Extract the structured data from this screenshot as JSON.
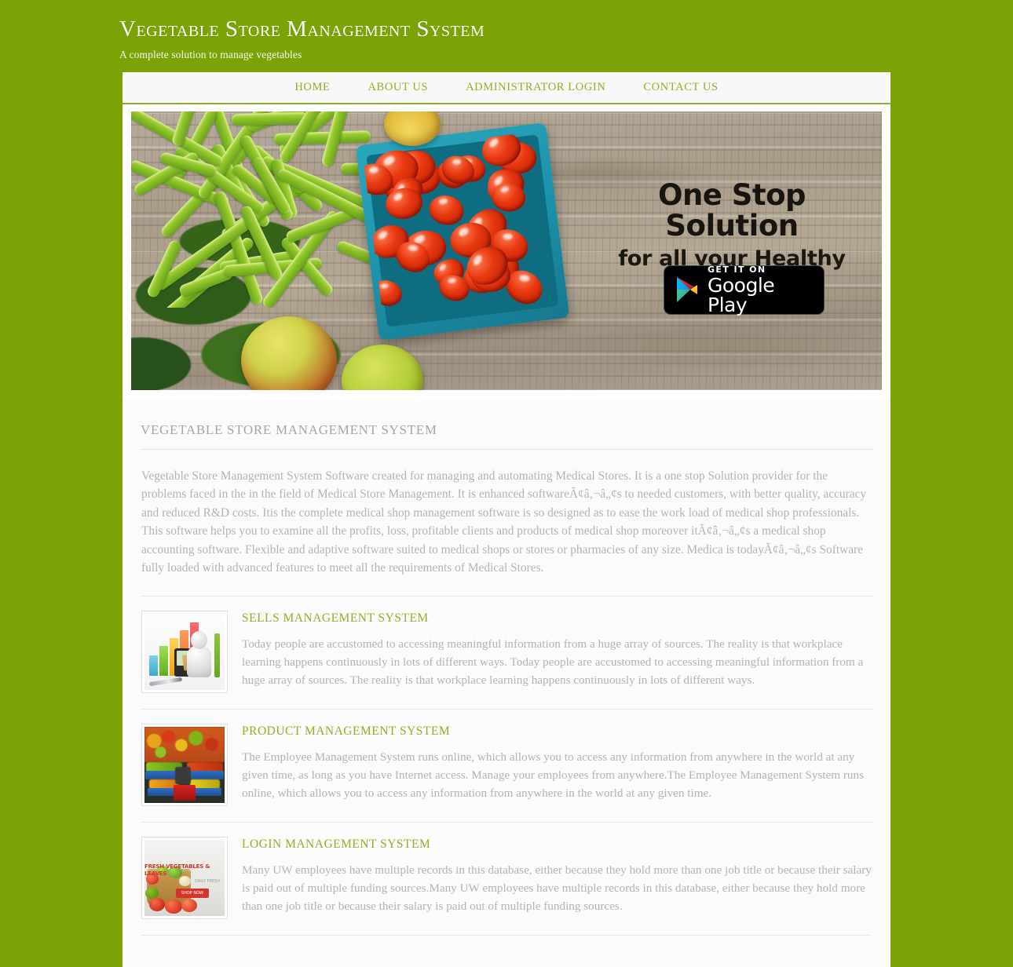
{
  "header": {
    "title": "Vegetable Store Management System",
    "tagline": "A complete solution to manage vegetables"
  },
  "nav": {
    "items": [
      {
        "label": "Home"
      },
      {
        "label": "About Us"
      },
      {
        "label": "Administrator Login"
      },
      {
        "label": "Contact Us"
      }
    ]
  },
  "banner": {
    "headline": "One Stop Solution",
    "subheadline": "for all your Healthy Needs",
    "badge": {
      "small_label": "GET IT ON",
      "big_label": "Google Play",
      "icon": "google-play-triangle-icon"
    },
    "image_alt": "green beans, cherry tomatoes in teal basket and apples on weathered wood"
  },
  "main": {
    "section_title": "Vegetable Store Management System",
    "intro": "Vegetable Store Management System Software created for managing and automating Medical Stores. It is a one stop Solution provider for the problems faced in the in the field of Medical Store Management. It is enhanced softwareÃ¢â‚¬â„¢s to needed customers, with better quality, accuracy and reduced R&D costs. Itis the complete medical shop management software is so designed as to ease the work load of medical shop professionals. This software helps you to examine all the profits, loss, profitable clients and products of medical shop moreover itÃ¢â‚¬â„¢s a medical shop accounting software. Flexible and adaptive software suited to medical shops or stores or pharmacies of any size. Medica is todayÃ¢â‚¬â„¢s Software fully loaded with advanced features to meet all the requirements of Medical Stores.",
    "features": [
      {
        "title": "Sells Management System",
        "text": "Today people are accustomed to accessing meaningful information from a huge array of sources. The reality is that workplace learning happens continuously in lots of different ways. Today people are accustomed to accessing meaningful information from a huge array of sources. The reality is that workplace learning happens continuously in lots of different ways.",
        "thumb_alt": "3d figure with pencil, bar chart and calculator"
      },
      {
        "title": "Product Management System",
        "text": "The Employee Management System runs online, which allows you to access any information from anywhere in the world at any given time, as long as you have Internet access. Manage your employees from anywhere.The Employee Management System runs online, which allows you to access any information from anywhere in the world at any given time.",
        "thumb_alt": "vegetable market stall with blue crates"
      },
      {
        "title": "Login Management System",
        "text": "Many UW employees have multiple records in this database, either because they hold more than one job title or because their salary is paid out of multiple funding sources.Many UW employees have multiple records in this database, either because they hold more than one job title or because their salary is paid out of multiple funding sources.",
        "thumb_alt": "basket of fresh vegetables promotional banner",
        "thumb_promo_line1": "FRESH VEGETABLES & LEAVES",
        "thumb_promo_line2": "DAILY FRESH",
        "thumb_promo_button": "SHOP NOW"
      }
    ]
  },
  "colors": {
    "page_background": "#7ba305",
    "accent_green": "#9aab24",
    "nav_border": "#8fae2a",
    "body_text": "#b3b3b3",
    "section_title": "#a6a6a6"
  }
}
